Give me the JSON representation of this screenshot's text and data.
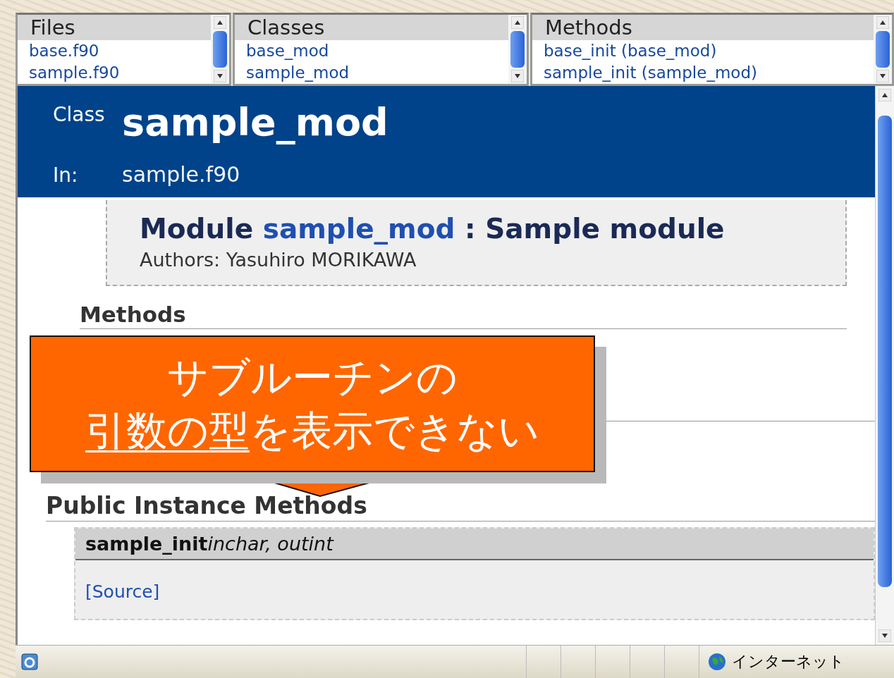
{
  "frames": [
    {
      "title": "Files",
      "items": [
        "base.f90",
        "sample.f90"
      ]
    },
    {
      "title": "Classes",
      "items": [
        "base_mod",
        "sample_mod"
      ]
    },
    {
      "title": "Methods",
      "items": [
        "base_init (base_mod)",
        "sample_init (sample_mod)"
      ]
    }
  ],
  "header": {
    "kind_label": "Class",
    "name": "sample_mod",
    "in_label": "In:",
    "file": "sample.f90"
  },
  "module_box": {
    "prefix": "Module",
    "link": "sample_mod",
    "suffix": ": Sample module",
    "authors": "Authors: Yasuhiro MORIKAWA"
  },
  "sections": [
    {
      "heading": "Methods"
    },
    {
      "heading": "Public Instance Methods"
    }
  ],
  "method": {
    "name": "sample_init",
    "args": "inchar, outint",
    "source_link": "[Source]"
  },
  "status_bar": {
    "zone": "インターネット"
  },
  "callout": {
    "line1": "サブルーチンの",
    "line2_underlined": "引数の型",
    "line2_rest": "を表示できない"
  }
}
